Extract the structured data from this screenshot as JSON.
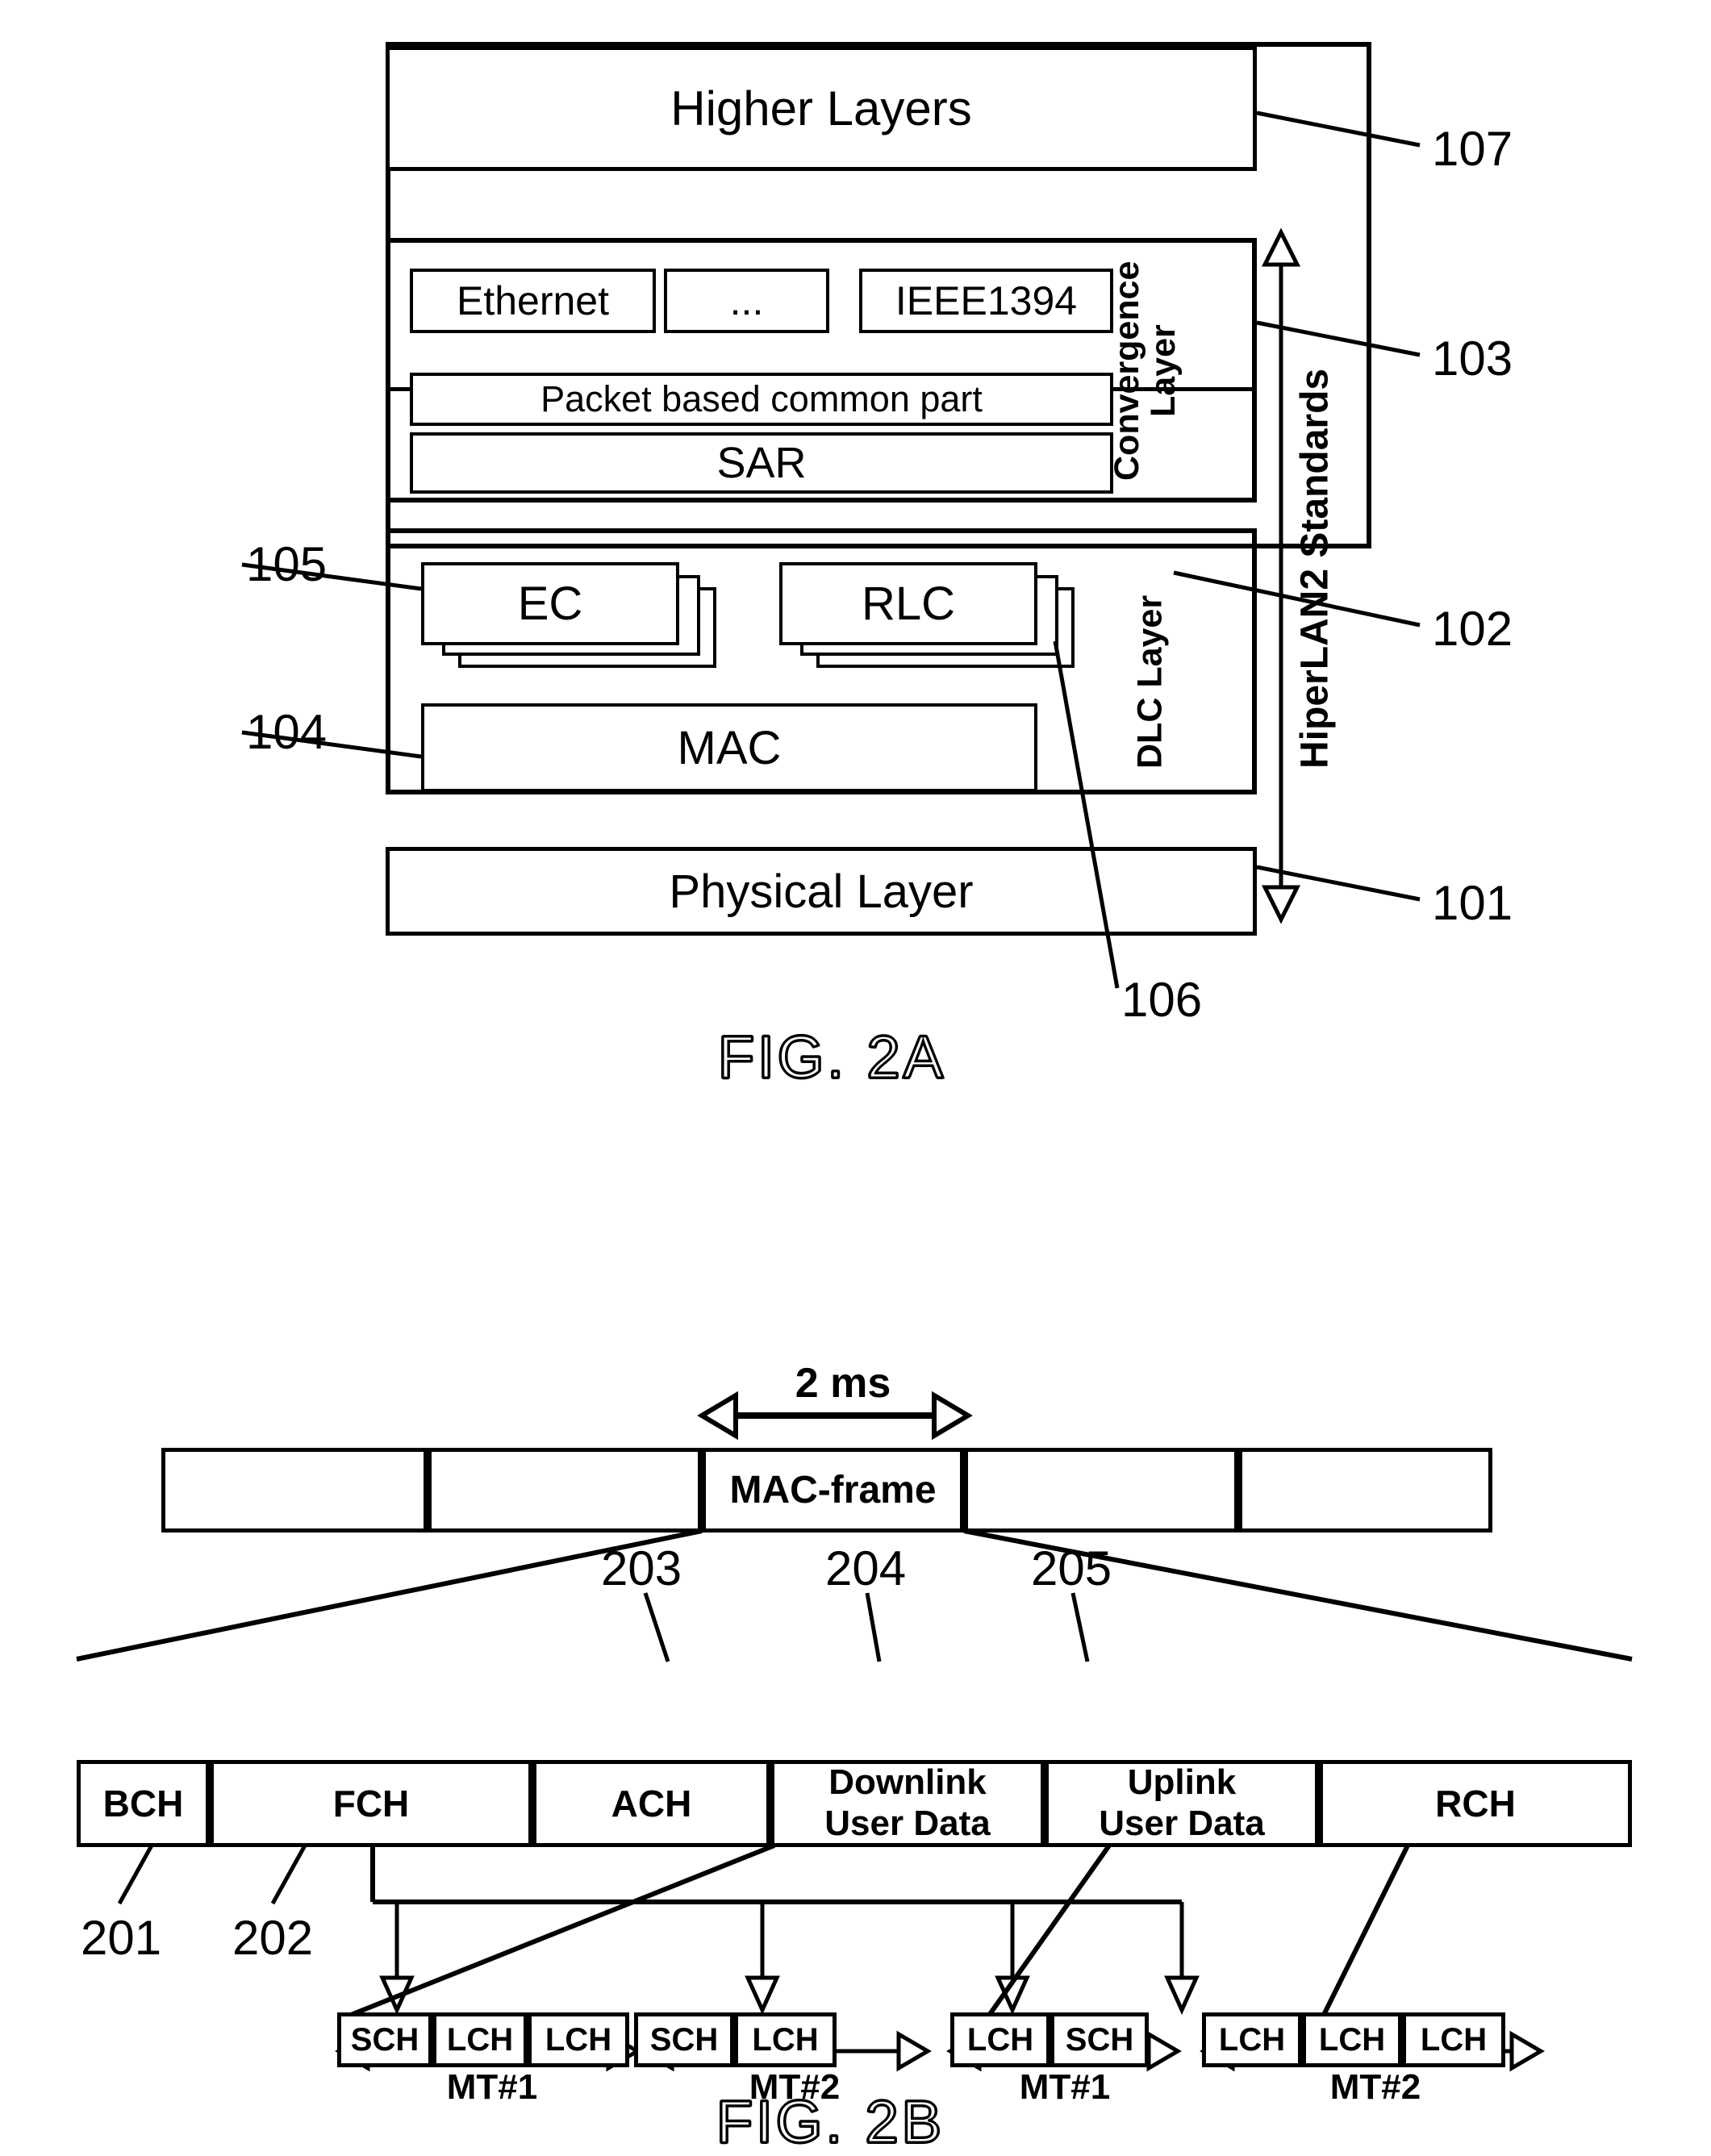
{
  "figures": [
    {
      "id": "fig2a",
      "caption": "FIG. 2A"
    },
    {
      "id": "fig2b",
      "caption": "FIG. 2B"
    }
  ],
  "fig2a": {
    "caption": "FIG. 2A",
    "layers": {
      "higher_layers": "Higher Layers",
      "physical_layer": "Physical Layer",
      "convergence_label": "Convergence\nLayer",
      "convergence_label_line1": "Convergence",
      "convergence_label_line2": "Layer",
      "dlc_label": "DLC Layer",
      "hiperlan_label": "HiperLAN2 Standards"
    },
    "convergence_sublayers": {
      "ethernet": "Ethernet",
      "ellipsis": "...",
      "ieee1394": "IEEE1394",
      "packet_common": "Packet based common part",
      "sar": "SAR"
    },
    "dlc_sublayers": {
      "ec": "EC",
      "rlc": "RLC",
      "mac": "MAC"
    },
    "reference_numbers": {
      "r101": "101",
      "r102": "102",
      "r103": "103",
      "r104": "104",
      "r105": "105",
      "r106": "106",
      "r107": "107"
    }
  },
  "fig2b": {
    "caption": "FIG. 2B",
    "duration_label": "2 ms",
    "mac_frame_label": "MAC-frame",
    "frame_slots": [
      "",
      "",
      "MAC-frame",
      "",
      ""
    ],
    "channels": [
      {
        "label": "BCH",
        "ref": "201"
      },
      {
        "label": "FCH",
        "ref": "202"
      },
      {
        "label": "ACH",
        "ref": "203"
      },
      {
        "label": "Downlink\nUser Data",
        "ref": "204"
      },
      {
        "label": "Uplink\nUser Data",
        "ref": "205"
      },
      {
        "label": "RCH",
        "ref": ""
      }
    ],
    "channel_labels": {
      "bch": "BCH",
      "fch": "FCH",
      "ach": "ACH",
      "downlink_line1": "Downlink",
      "downlink_line2": "User Data",
      "uplink_line1": "Uplink",
      "uplink_line2": "User Data",
      "rch": "RCH"
    },
    "reference_numbers": {
      "r201": "201",
      "r202": "202",
      "r203": "203",
      "r204": "204",
      "r205": "205"
    },
    "subframe_groups": [
      {
        "mt": "MT#1",
        "cells": [
          "SCH",
          "LCH",
          "LCH"
        ]
      },
      {
        "mt": "MT#2",
        "cells": [
          "SCH",
          "LCH"
        ]
      },
      {
        "mt": "MT#1",
        "cells": [
          "LCH",
          "SCH"
        ]
      },
      {
        "mt": "MT#2",
        "cells": [
          "LCH",
          "LCH",
          "LCH"
        ]
      }
    ],
    "mt_labels": [
      "MT#1",
      "MT#2",
      "MT#1",
      "MT#2"
    ]
  },
  "colors": {
    "ink": "#000000",
    "paper": "#ffffff"
  }
}
